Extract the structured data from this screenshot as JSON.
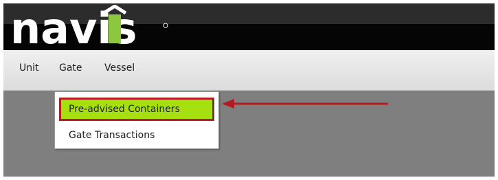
{
  "brand": {
    "logo_text": "navis"
  },
  "menu": {
    "items": [
      {
        "label": "Unit"
      },
      {
        "label": "Gate"
      },
      {
        "label": "Vessel"
      }
    ]
  },
  "dropdown": {
    "options": [
      {
        "label": "Pre-advised Containers",
        "highlighted": true
      },
      {
        "label": "Gate Transactions",
        "highlighted": false
      }
    ]
  },
  "colors": {
    "header_bg": "#050505",
    "menubar_bg": "#e6e6e6",
    "workspace_bg": "#7f7f7f",
    "highlight_fill": "#a6e10f",
    "annotation_red": "#b31b21",
    "logo_green": "#8dc63f"
  }
}
